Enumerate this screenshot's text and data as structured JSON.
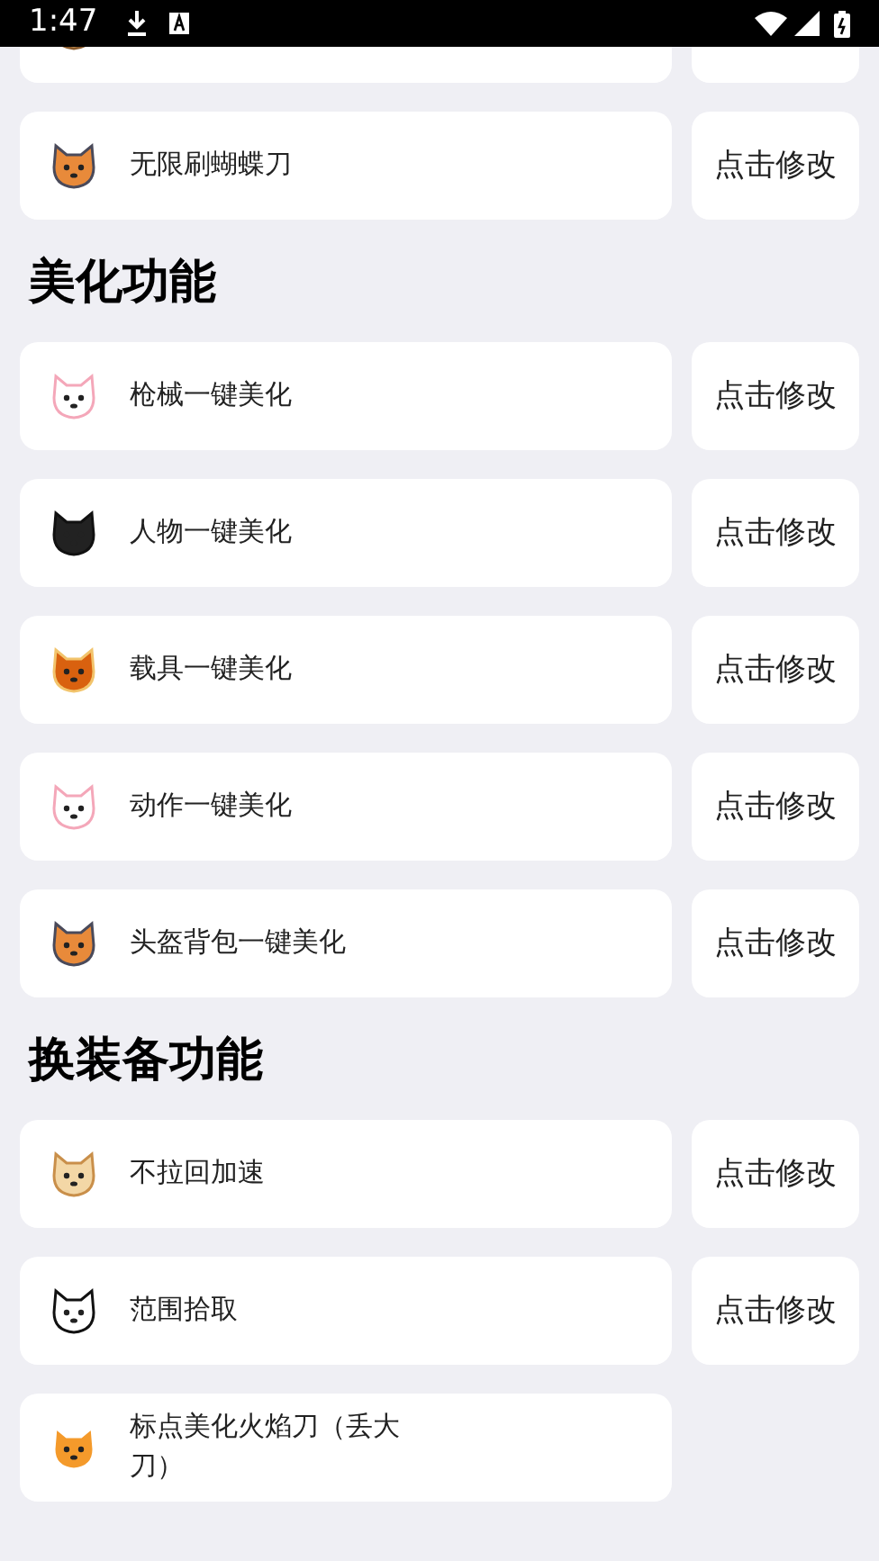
{
  "status_bar": {
    "time": "1:47"
  },
  "sections": [
    {
      "items": [
        {
          "kind": "clipped"
        },
        {
          "kind": "row",
          "label": "无限刷蝴蝶刀",
          "button": "点击修改"
        }
      ]
    },
    {
      "heading": "美化功能",
      "items": [
        {
          "kind": "row",
          "label": "枪械一键美化",
          "button": "点击修改"
        },
        {
          "kind": "row",
          "label": "人物一键美化",
          "button": "点击修改"
        },
        {
          "kind": "row",
          "label": "载具一键美化",
          "button": "点击修改"
        },
        {
          "kind": "row",
          "label": "动作一键美化",
          "button": "点击修改"
        },
        {
          "kind": "row",
          "label": "头盔背包一键美化",
          "button": "点击修改"
        }
      ]
    },
    {
      "heading": "换装备功能",
      "items": [
        {
          "kind": "row",
          "label": "不拉回加速",
          "button": "点击修改"
        },
        {
          "kind": "row",
          "label": "范围拾取",
          "button": "点击修改"
        },
        {
          "kind": "row",
          "label": "标点美化火焰刀（丢大刀）"
        }
      ]
    }
  ]
}
